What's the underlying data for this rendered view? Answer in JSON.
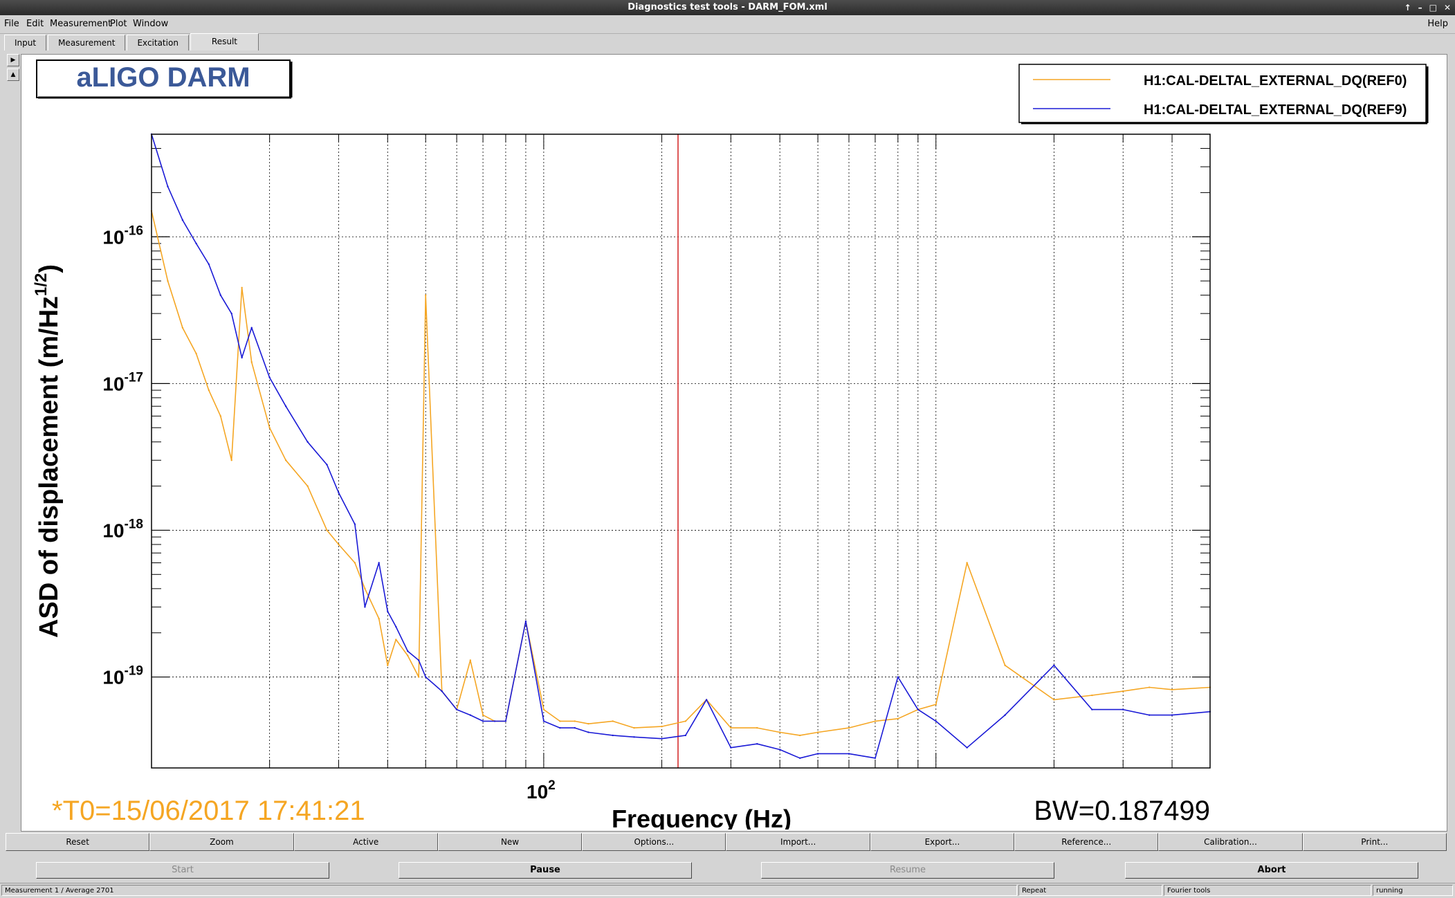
{
  "window": {
    "title": "Diagnostics test tools - DARM_FOM.xml",
    "controls": [
      "↑",
      "–",
      "□",
      "✕"
    ]
  },
  "menu": {
    "file": "File",
    "edit": "Edit",
    "measurement": "Measurement",
    "plot": "Plot",
    "window": "Window",
    "help": "Help"
  },
  "tabs": {
    "input": "Input",
    "measurement": "Measurement",
    "excitation": "Excitation",
    "result": "Result"
  },
  "plot": {
    "title_box": "aLIGO DARM",
    "t0": "*T0=15/06/2017 17:41:21",
    "bw": "BW=0.187499",
    "cursor_frequency_hz": 220,
    "colors": {
      "ref0": "#f5a623",
      "ref9": "#1a1ad6",
      "cursor": "#d22020",
      "t0_text": "#f5a623",
      "title_text": "#3b5998"
    }
  },
  "chart_data": {
    "type": "line",
    "title": "",
    "xlabel": "Frequency (Hz)",
    "ylabel": "ASD of displacement (m/Hz^1/2)",
    "x_scale": "log",
    "y_scale": "log",
    "xlim": [
      10,
      5000
    ],
    "ylim": [
      2.4e-20,
      5e-16
    ],
    "y_ticks": [
      "10^-16",
      "10^-17",
      "10^-18",
      "10^-19"
    ],
    "x_ticks": [
      "10^2"
    ],
    "grid": true,
    "legend_position": "top-right",
    "series": [
      {
        "name": "H1:CAL-DELTAL_EXTERNAL_DQ(REF0)",
        "color": "#f5a623",
        "x": [
          10,
          11,
          12,
          13,
          14,
          15,
          16,
          17,
          18,
          20,
          22,
          25,
          28,
          30,
          33,
          35,
          38,
          40,
          42,
          45,
          48,
          50,
          55,
          60,
          65,
          70,
          75,
          80,
          90,
          100,
          110,
          120,
          130,
          150,
          170,
          200,
          230,
          260,
          300,
          350,
          400,
          450,
          500,
          600,
          700,
          800,
          900,
          1000,
          1200,
          1500,
          2000,
          2500,
          3000,
          3500,
          4000,
          5000
        ],
        "y": [
          1.5e-16,
          5e-17,
          2.4e-17,
          1.6e-17,
          9e-18,
          6e-18,
          3e-18,
          4.5e-17,
          1.4e-17,
          5e-18,
          3e-18,
          2e-18,
          1e-18,
          8e-19,
          6e-19,
          4e-19,
          2.5e-19,
          1.2e-19,
          1.8e-19,
          1.4e-19,
          1e-19,
          4e-17,
          8e-20,
          6e-20,
          1.3e-19,
          5.5e-20,
          5e-20,
          5e-20,
          2.4e-19,
          6e-20,
          5e-20,
          5e-20,
          4.8e-20,
          5e-20,
          4.5e-20,
          4.6e-20,
          5e-20,
          7e-20,
          4.5e-20,
          4.5e-20,
          4.2e-20,
          4e-20,
          4.2e-20,
          4.5e-20,
          5e-20,
          5.2e-20,
          6e-20,
          6.5e-20,
          6e-19,
          1.2e-19,
          7e-20,
          7.5e-20,
          8e-20,
          8.5e-20,
          8.2e-20,
          8.5e-20
        ]
      },
      {
        "name": "H1:CAL-DELTAL_EXTERNAL_DQ(REF9)",
        "color": "#1a1ad6",
        "x": [
          10,
          11,
          12,
          13,
          14,
          15,
          16,
          17,
          18,
          20,
          22,
          25,
          28,
          30,
          33,
          35,
          38,
          40,
          42,
          45,
          48,
          50,
          55,
          60,
          65,
          70,
          75,
          80,
          90,
          100,
          110,
          120,
          130,
          150,
          170,
          200,
          230,
          260,
          300,
          350,
          400,
          450,
          500,
          600,
          700,
          800,
          900,
          1000,
          1200,
          1500,
          2000,
          2500,
          3000,
          3500,
          4000,
          5000
        ],
        "y": [
          5e-16,
          2.2e-16,
          1.3e-16,
          9e-17,
          6.5e-17,
          4e-17,
          3e-17,
          1.5e-17,
          2.4e-17,
          1.1e-17,
          7e-18,
          4e-18,
          2.8e-18,
          1.8e-18,
          1.1e-18,
          3e-19,
          6e-19,
          2.8e-19,
          2.2e-19,
          1.5e-19,
          1.3e-19,
          1e-19,
          8e-20,
          6e-20,
          5.5e-20,
          5e-20,
          5e-20,
          5e-20,
          2.4e-19,
          5e-20,
          4.5e-20,
          4.5e-20,
          4.2e-20,
          4e-20,
          3.9e-20,
          3.8e-20,
          4e-20,
          7e-20,
          3.3e-20,
          3.5e-20,
          3.2e-20,
          2.8e-20,
          3e-20,
          3e-20,
          2.8e-20,
          1e-19,
          6e-20,
          5e-20,
          3.3e-20,
          5.5e-20,
          1.2e-19,
          6e-20,
          6e-20,
          5.5e-20,
          5.5e-20,
          5.8e-20
        ]
      }
    ]
  },
  "buttons": {
    "reset": "Reset",
    "zoom": "Zoom",
    "active": "Active",
    "new": "New",
    "options": "Options...",
    "import": "Import...",
    "export": "Export...",
    "reference": "Reference...",
    "calibration": "Calibration...",
    "print": "Print..."
  },
  "controls": {
    "start": "Start",
    "pause": "Pause",
    "resume": "Resume",
    "abort": "Abort"
  },
  "status": {
    "measurement": "Measurement 1 / Average 2701",
    "repeat": "Repeat",
    "fourier": "Fourier tools",
    "state": "running"
  }
}
